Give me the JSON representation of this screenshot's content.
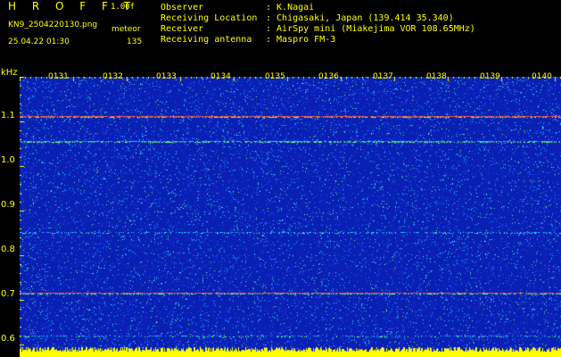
{
  "header": {
    "app_title": "H R O F F T",
    "version": "1.00f",
    "filename": "KN9_2504220130.png",
    "meteor_label": "meteor",
    "datetime": "25.04.22 01:30",
    "meteor_count": "135",
    "info": [
      {
        "label": "Observer",
        "value": ": K.Nagai"
      },
      {
        "label": "Receiving Location",
        "value": ": Chigasaki, Japan (139.414 35.340)"
      },
      {
        "label": "Receiver",
        "value": ": AirSpy mini (Miakejima VOR 108.65MHz)"
      },
      {
        "label": "Receiving antenna",
        "value": ": Maspro FM-3"
      }
    ]
  },
  "plot": {
    "y_unit": "kHz",
    "y_ticks": [
      "1.1",
      "1.0",
      "0.9",
      "0.8",
      "0.7",
      "0.6"
    ],
    "x_ticks": [
      "0131",
      "0132",
      "0133",
      "0134",
      "0135",
      "0136",
      "0137",
      "0138",
      "0139",
      "0140"
    ],
    "colors": {
      "background": "#0a1fb4",
      "noise_low": "#1e5cff",
      "noise_mid": "#20c8ff",
      "noise_high": "#7fff70",
      "carrier": "#ff5a3c",
      "bottom_band": "#ffff00",
      "tick": "#ffff00"
    }
  }
}
